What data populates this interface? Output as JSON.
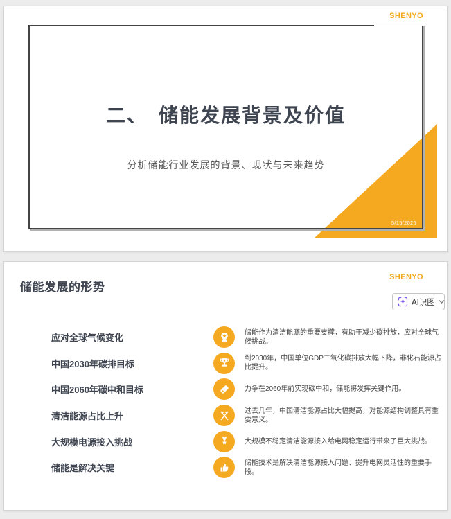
{
  "colors": {
    "accent": "#F5A920",
    "title": "#3E4450",
    "ai_purple": "#7B55F0",
    "logo_orange": "#F5A81C",
    "background": "#ECECEC"
  },
  "slide1": {
    "logo": "SHENYO",
    "title": "二、　储能发展背景及价值",
    "subtitle": "分析储能行业发展的背景、现状与未来趋势",
    "date": "5/15/2025"
  },
  "slide2": {
    "logo": "SHENYO",
    "title": "储能发展的形势",
    "ai_button": {
      "label": "AI识图"
    },
    "rows": [
      {
        "heading": "应对全球气候变化",
        "icon": "award-ribbon-icon",
        "text": "储能作为清洁能源的重要支撑，有助于减少碳排放，应对全球气候挑战。"
      },
      {
        "heading": "中国2030年碳排目标",
        "icon": "trophy-icon",
        "text": "到2030年，中国单位GDP二氧化碳排放大幅下降，非化石能源占比提升。"
      },
      {
        "heading": "中国2060年碳中和目标",
        "icon": "price-tag-icon",
        "text": "力争在2060年前实现碳中和，储能将发挥关键作用。"
      },
      {
        "heading": "清洁能源占比上升",
        "icon": "crossed-flags-icon",
        "text": "过去几年，中国清洁能源占比大幅提高，对能源结构调整具有重要意义。"
      },
      {
        "heading": "大规模电源接入挑战",
        "icon": "medal-star-icon",
        "text": "大规模不稳定清洁能源接入给电网稳定运行带来了巨大挑战。"
      },
      {
        "heading": "储能是解决关键",
        "icon": "thumbs-up-icon",
        "text": "储能技术是解决清洁能源接入问题、提升电网灵活性的重要手段。"
      }
    ]
  }
}
